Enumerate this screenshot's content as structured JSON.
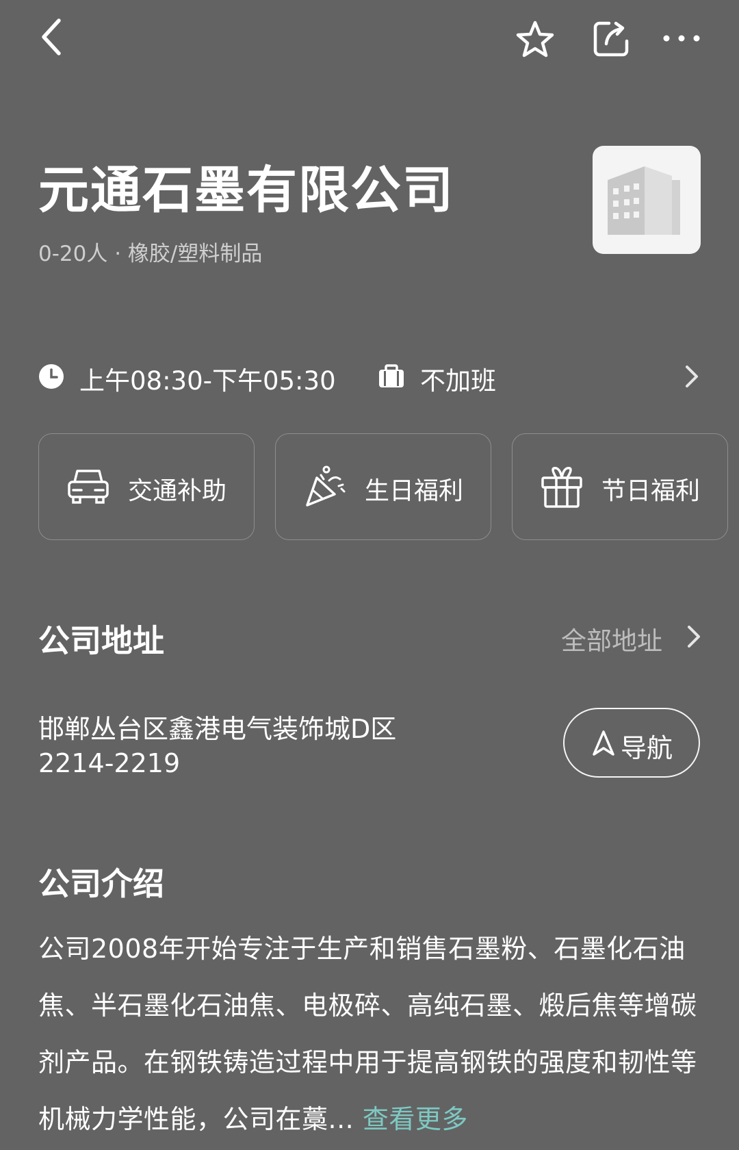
{
  "header": {
    "back_label": "back-icon",
    "favorite_label": "star-icon",
    "share_label": "share-icon",
    "more_label": "more-icon"
  },
  "company": {
    "name": "元通石墨有限公司",
    "meta": "0-20人 · 橡胶/塑料制品"
  },
  "work": {
    "hours": "上午08:30-下午05:30",
    "overtime": "不加班"
  },
  "benefits": [
    {
      "label": "交通补助",
      "icon": "car-icon"
    },
    {
      "label": "生日福利",
      "icon": "party-popper-icon"
    },
    {
      "label": "节日福利",
      "icon": "gift-icon"
    }
  ],
  "address": {
    "title": "公司地址",
    "all_link": "全部地址",
    "text": "邯郸丛台区鑫港电气装饰城D区2214-2219",
    "nav_label": "导航"
  },
  "intro": {
    "title": "公司介绍",
    "text": "公司2008年开始专注于生产和销售石墨粉、石墨化石油焦、半石墨化石油焦、电极碎、高纯石墨、煅后焦等增碳剂产品。在钢铁铸造过程中用于提高钢铁的强度和韧性等机械力学性能，公司在藁...",
    "more_label": "查看更多"
  },
  "colors": {
    "background": "#636363",
    "accent": "#7ec9c3",
    "muted": "#bdbdbd"
  }
}
